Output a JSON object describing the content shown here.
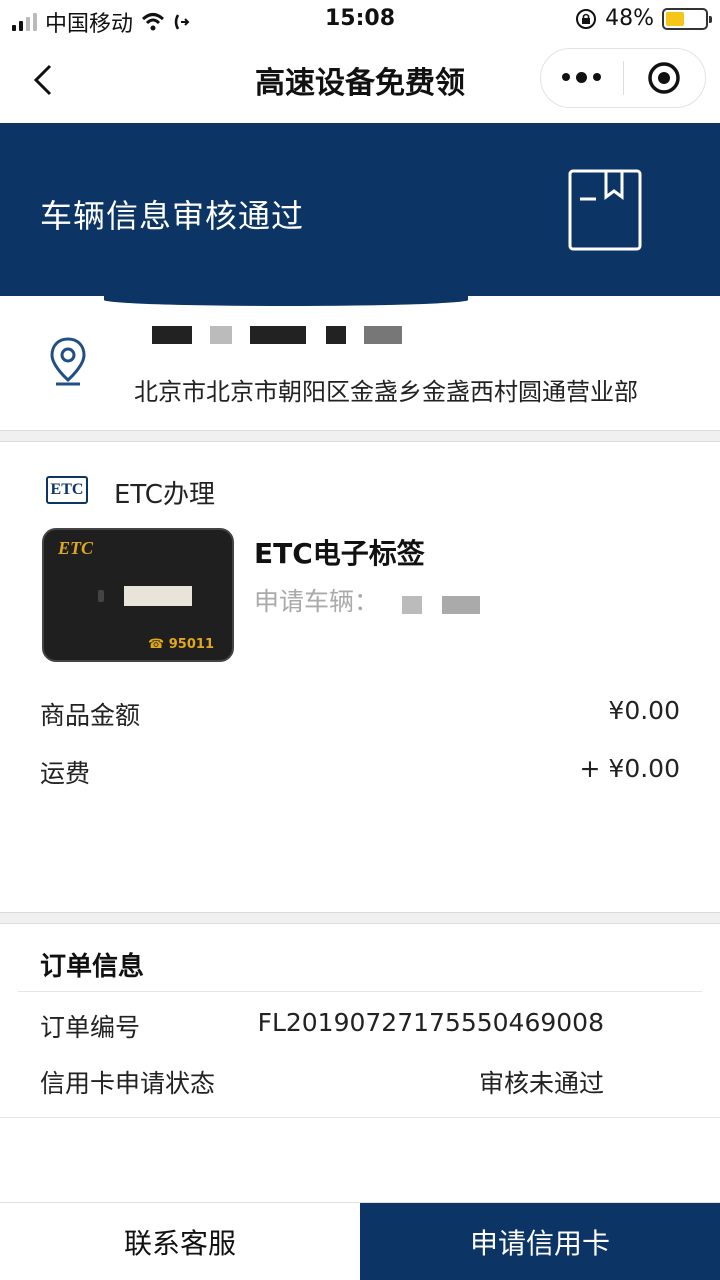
{
  "status_bar": {
    "carrier": "中国移动",
    "time": "15:08",
    "battery": "48%",
    "battery_level": 0.48
  },
  "nav": {
    "title": "高速设备免费领",
    "icons": [
      "back-chevron-icon",
      "more-dots-icon",
      "target-icon"
    ]
  },
  "banner": {
    "status_text": "车辆信息审核通过",
    "icon": "clipboard-icon",
    "bg_color": "#0c3565"
  },
  "address": {
    "text": "北京市北京市朝阳区金盏乡金盏西村圆通营业部",
    "icon": "location-pin-icon"
  },
  "product": {
    "section_tag": "ETC",
    "section_label": "ETC办理",
    "device_logo": "ETC",
    "device_hotline": "☎ 95011",
    "name": "ETC电子标签",
    "vehicle_label": "申请车辆：",
    "price_label": "商品金额",
    "price_value": "¥0.00",
    "shipping_label": "运费",
    "shipping_value": "+ ¥0.00"
  },
  "order": {
    "title": "订单信息",
    "number_label": "订单编号",
    "number_value": "FL20190727175550469008",
    "status_label": "信用卡申请状态",
    "status_value": "审核未通过"
  },
  "bottom": {
    "service_label": "联系客服",
    "apply_label": "申请信用卡",
    "accent": "#0c3565"
  }
}
